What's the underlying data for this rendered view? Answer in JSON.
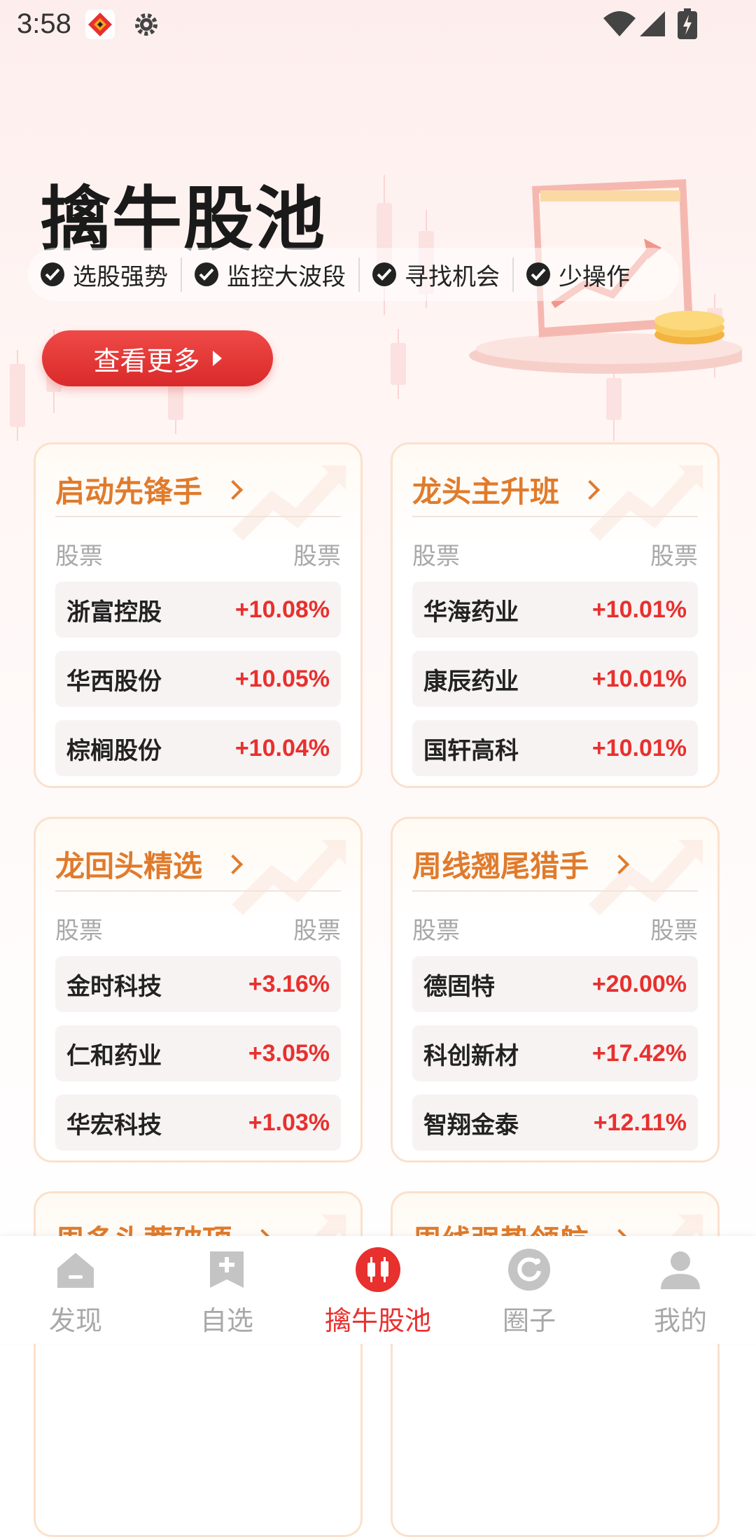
{
  "status_bar": {
    "time": "3:58"
  },
  "hero": {
    "title": "擒牛股池",
    "features": [
      "选股强势",
      "监控大波段",
      "寻找机会",
      "少操作"
    ],
    "more_button": "查看更多"
  },
  "cards": [
    {
      "title": "启动先锋手",
      "col_left": "股票",
      "col_right": "股票",
      "rows": [
        {
          "name": "浙富控股",
          "change": "+10.08%"
        },
        {
          "name": "华西股份",
          "change": "+10.05%"
        },
        {
          "name": "棕榈股份",
          "change": "+10.04%"
        }
      ]
    },
    {
      "title": "龙头主升班",
      "col_left": "股票",
      "col_right": "股票",
      "rows": [
        {
          "name": "华海药业",
          "change": "+10.01%"
        },
        {
          "name": "康辰药业",
          "change": "+10.01%"
        },
        {
          "name": "国轩高科",
          "change": "+10.01%"
        }
      ]
    },
    {
      "title": "龙回头精选",
      "col_left": "股票",
      "col_right": "股票",
      "rows": [
        {
          "name": "金时科技",
          "change": "+3.16%"
        },
        {
          "name": "仁和药业",
          "change": "+3.05%"
        },
        {
          "name": "华宏科技",
          "change": "+1.03%"
        }
      ]
    },
    {
      "title": "周线翘尾猎手",
      "col_left": "股票",
      "col_right": "股票",
      "rows": [
        {
          "name": "德固特",
          "change": "+20.00%"
        },
        {
          "name": "科创新材",
          "change": "+17.42%"
        },
        {
          "name": "智翔金泰",
          "change": "+12.11%"
        }
      ]
    },
    {
      "title": "周多头蓄破顶"
    },
    {
      "title": "周线强势领航"
    }
  ],
  "tabs": [
    {
      "label": "发现",
      "icon": "home-icon"
    },
    {
      "label": "自选",
      "icon": "add-watchlist-icon"
    },
    {
      "label": "擒牛股池",
      "icon": "candlestick-icon",
      "active": true
    },
    {
      "label": "圈子",
      "icon": "circle-icon"
    },
    {
      "label": "我的",
      "icon": "profile-icon"
    }
  ],
  "colors": {
    "accent_red": "#e8302e",
    "title_orange": "#e07b2c",
    "card_border": "#fbe1cc"
  }
}
